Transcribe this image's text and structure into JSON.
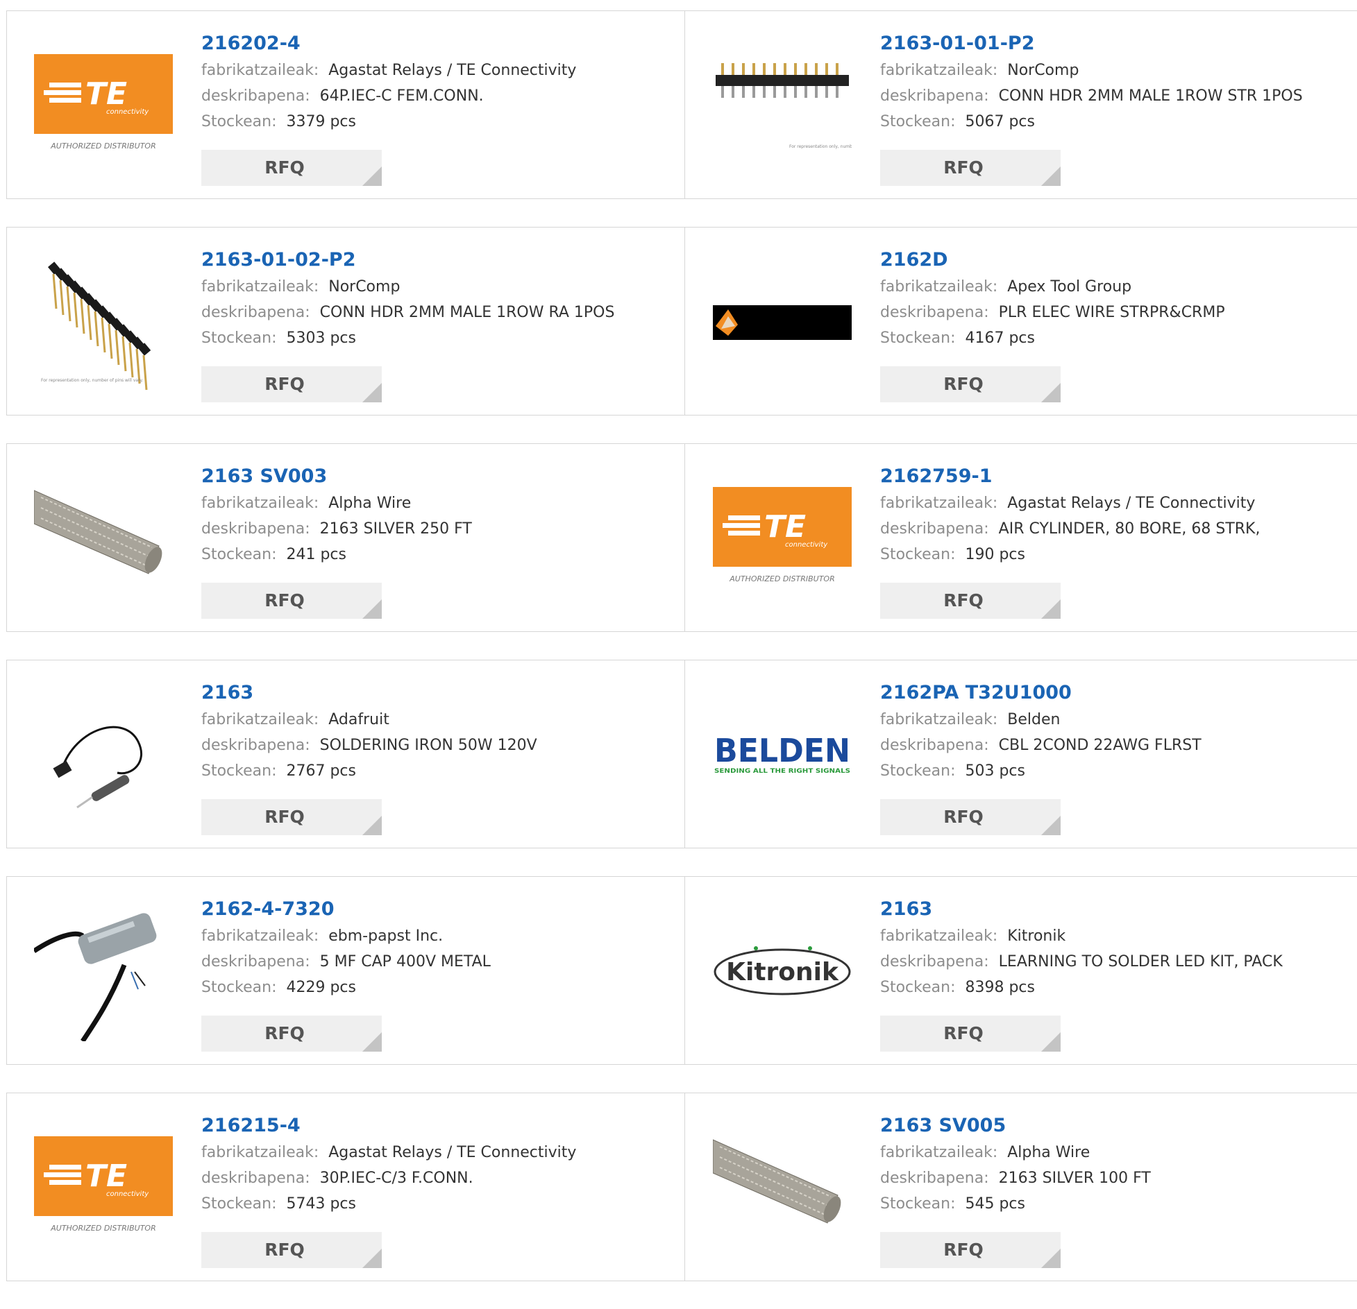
{
  "labels": {
    "manufacturer": "fabrikatzaileak:",
    "description": "deskribapena:",
    "stock": "Stockean:",
    "rfq": "RFQ"
  },
  "logo_text": {
    "te_brand": "TE",
    "te_sub": "connectivity",
    "te_authorized": "AUTHORIZED DISTRIBUTOR",
    "belden": "BELDEN",
    "belden_tagline": "SENDING ALL THE RIGHT SIGNALS",
    "kitronik": "Kitronik",
    "sample_note": "For representation only, number of pins will vary."
  },
  "colors": {
    "part_link": "#1a64b4",
    "te_orange": "#f28d22",
    "belden_blue": "#1b4a9c",
    "belden_green": "#2b9a3c"
  },
  "products": [
    {
      "part": "216202-4",
      "manufacturer": "Agastat Relays / TE Connectivity",
      "description": "64P.IEC-C FEM.CONN.",
      "stock": "3379 pcs",
      "image": "te-logo"
    },
    {
      "part": "2163-01-01-P2",
      "manufacturer": "NorComp",
      "description": "CONN HDR 2MM MALE 1ROW STR 1POS",
      "stock": "5067 pcs",
      "image": "pin-header-straight"
    },
    {
      "part": "2163-01-02-P2",
      "manufacturer": "NorComp",
      "description": "CONN HDR 2MM MALE 1ROW RA 1POS",
      "stock": "5303 pcs",
      "image": "pin-header-right-angle"
    },
    {
      "part": "2162D",
      "manufacturer": "Apex Tool Group",
      "description": "PLR ELEC WIRE STRPR&CRMP",
      "stock": "4167 pcs",
      "image": "apex-logo"
    },
    {
      "part": "2163 SV003",
      "manufacturer": "Alpha Wire",
      "description": "2163 SILVER 250 FT",
      "stock": "241 pcs",
      "image": "braided-sleeve"
    },
    {
      "part": "2162759-1",
      "manufacturer": "Agastat Relays / TE Connectivity",
      "description": "AIR CYLINDER, 80 BORE, 68 STRK,",
      "stock": "190 pcs",
      "image": "te-logo"
    },
    {
      "part": "2163",
      "manufacturer": "Adafruit",
      "description": "SOLDERING IRON 50W 120V",
      "stock": "2767 pcs",
      "image": "soldering-iron"
    },
    {
      "part": "2162PA T32U1000",
      "manufacturer": "Belden",
      "description": "CBL 2COND 22AWG FLRST",
      "stock": "503 pcs",
      "image": "belden-logo"
    },
    {
      "part": "2162-4-7320",
      "manufacturer": "ebm-papst Inc.",
      "description": "5 MF CAP 400V METAL",
      "stock": "4229 pcs",
      "image": "capacitor"
    },
    {
      "part": "2163",
      "manufacturer": "Kitronik",
      "description": "LEARNING TO SOLDER LED KIT, PACK",
      "stock": "8398 pcs",
      "image": "kitronik-logo"
    },
    {
      "part": "216215-4",
      "manufacturer": "Agastat Relays / TE Connectivity",
      "description": "30P.IEC-C/3 F.CONN.",
      "stock": "5743 pcs",
      "image": "te-logo"
    },
    {
      "part": "2163 SV005",
      "manufacturer": "Alpha Wire",
      "description": "2163 SILVER 100 FT",
      "stock": "545 pcs",
      "image": "braided-sleeve"
    }
  ]
}
